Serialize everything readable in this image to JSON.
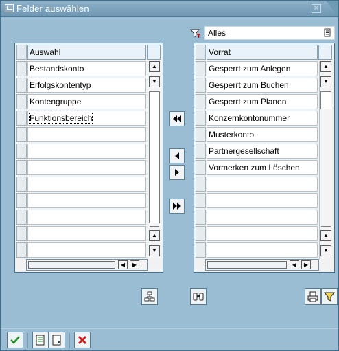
{
  "window": {
    "title": "Felder auswählen"
  },
  "filter": {
    "value": "Alles"
  },
  "left_table": {
    "header": "Auswahl",
    "rows": [
      "Bestandskonto",
      "Erfolgskontentyp",
      "Kontengruppe",
      "Funktionsbereich",
      "",
      "",
      "",
      "",
      "",
      "",
      "",
      ""
    ]
  },
  "right_table": {
    "header": "Vorrat",
    "rows": [
      "Gesperrt zum Anlegen",
      "Gesperrt zum Buchen",
      "Gesperrt zum Planen",
      "Konzernkontonummer",
      "Musterkonto",
      "Partnergesellschaft",
      "Vormerken zum Löschen",
      "",
      "",
      "",
      "",
      ""
    ]
  },
  "icons": {
    "title": "window-icon",
    "close": "close-icon",
    "filter": "filter-icon",
    "move_all_left": "double-left-arrow-icon",
    "move_left": "left-arrow-icon",
    "move_right": "right-arrow-icon",
    "move_all_right": "double-right-arrow-icon",
    "confirm": "checkmark-icon",
    "cancel": "cross-icon"
  },
  "colors": {
    "dialog_bg": "#9bbdd3",
    "title_bg": "#7ea5be",
    "accent_green": "#1e8f1e",
    "accent_red": "#d01818"
  }
}
